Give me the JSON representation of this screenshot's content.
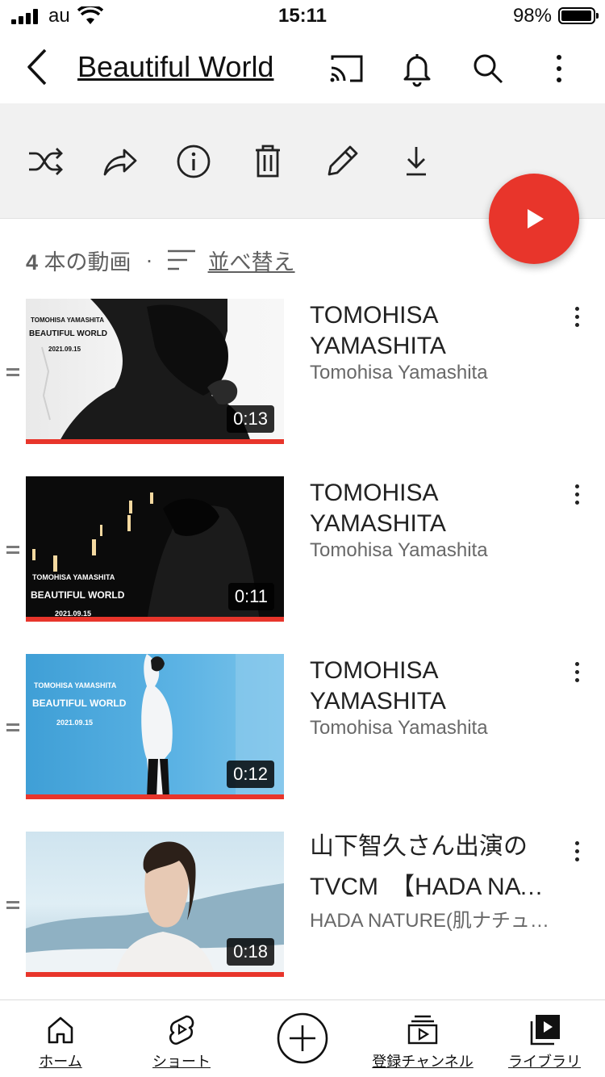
{
  "status_bar": {
    "carrier": "au",
    "time": "15:11",
    "battery": "98%"
  },
  "header": {
    "title": "Beautiful  World"
  },
  "playlist": {
    "count_number": "4",
    "count_suffix": " 本の動画",
    "separator": "·",
    "sort_label": "並べ替え"
  },
  "videos": [
    {
      "title_line1": "TOMOHISA",
      "title_line2": "YAMASHITA",
      "channel": "Tomohisa Yamashita",
      "duration": "0:13",
      "thumb_texts": [
        "TOMOHISA YAMASHITA",
        "BEAUTIFUL WORLD",
        "2021.09.15"
      ]
    },
    {
      "title_line1": "TOMOHISA",
      "title_line2": "YAMASHITA",
      "channel": "Tomohisa Yamashita",
      "duration": "0:11",
      "thumb_texts": [
        "TOMOHISA YAMASHITA",
        "BEAUTIFUL WORLD",
        "2021.09.15"
      ]
    },
    {
      "title_line1": "TOMOHISA",
      "title_line2": "YAMASHITA",
      "channel": "Tomohisa Yamashita",
      "duration": "0:12",
      "thumb_texts": [
        "TOMOHISA YAMASHITA",
        "BEAUTIFUL WORLD",
        "2021.09.15"
      ]
    },
    {
      "title_line1": "山下智久さん出演の",
      "title_line2": "TVCM　【HADA NATURE】",
      "channel": "HADA NATURE(肌ナチュール)",
      "duration": "0:18",
      "thumb_texts": []
    }
  ],
  "bottom_nav": [
    {
      "label": "ホーム",
      "icon": "home-icon"
    },
    {
      "label": "ショート",
      "icon": "shorts-icon"
    },
    {
      "label": "",
      "icon": "create-icon"
    },
    {
      "label": "登録チャンネル",
      "icon": "subscriptions-icon"
    },
    {
      "label": "ライブラリ",
      "icon": "library-icon"
    }
  ],
  "colors": {
    "accent": "#e8352b",
    "action_bar_bg": "#f1f1f1",
    "secondary_text": "#606060"
  }
}
